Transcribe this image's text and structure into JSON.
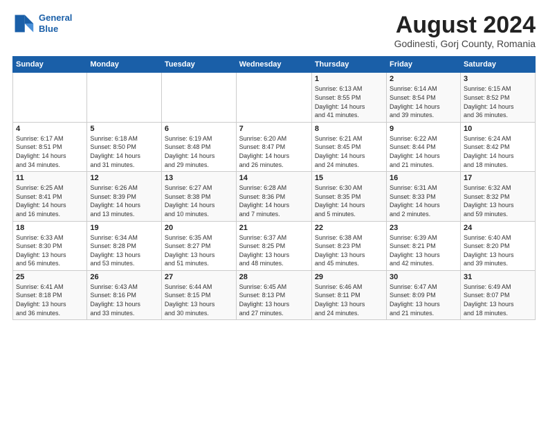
{
  "header": {
    "logo_line1": "General",
    "logo_line2": "Blue",
    "main_title": "August 2024",
    "subtitle": "Godinesti, Gorj County, Romania"
  },
  "calendar": {
    "days_of_week": [
      "Sunday",
      "Monday",
      "Tuesday",
      "Wednesday",
      "Thursday",
      "Friday",
      "Saturday"
    ],
    "weeks": [
      [
        {
          "day": "",
          "info": ""
        },
        {
          "day": "",
          "info": ""
        },
        {
          "day": "",
          "info": ""
        },
        {
          "day": "",
          "info": ""
        },
        {
          "day": "1",
          "info": "Sunrise: 6:13 AM\nSunset: 8:55 PM\nDaylight: 14 hours\nand 41 minutes."
        },
        {
          "day": "2",
          "info": "Sunrise: 6:14 AM\nSunset: 8:54 PM\nDaylight: 14 hours\nand 39 minutes."
        },
        {
          "day": "3",
          "info": "Sunrise: 6:15 AM\nSunset: 8:52 PM\nDaylight: 14 hours\nand 36 minutes."
        }
      ],
      [
        {
          "day": "4",
          "info": "Sunrise: 6:17 AM\nSunset: 8:51 PM\nDaylight: 14 hours\nand 34 minutes."
        },
        {
          "day": "5",
          "info": "Sunrise: 6:18 AM\nSunset: 8:50 PM\nDaylight: 14 hours\nand 31 minutes."
        },
        {
          "day": "6",
          "info": "Sunrise: 6:19 AM\nSunset: 8:48 PM\nDaylight: 14 hours\nand 29 minutes."
        },
        {
          "day": "7",
          "info": "Sunrise: 6:20 AM\nSunset: 8:47 PM\nDaylight: 14 hours\nand 26 minutes."
        },
        {
          "day": "8",
          "info": "Sunrise: 6:21 AM\nSunset: 8:45 PM\nDaylight: 14 hours\nand 24 minutes."
        },
        {
          "day": "9",
          "info": "Sunrise: 6:22 AM\nSunset: 8:44 PM\nDaylight: 14 hours\nand 21 minutes."
        },
        {
          "day": "10",
          "info": "Sunrise: 6:24 AM\nSunset: 8:42 PM\nDaylight: 14 hours\nand 18 minutes."
        }
      ],
      [
        {
          "day": "11",
          "info": "Sunrise: 6:25 AM\nSunset: 8:41 PM\nDaylight: 14 hours\nand 16 minutes."
        },
        {
          "day": "12",
          "info": "Sunrise: 6:26 AM\nSunset: 8:39 PM\nDaylight: 14 hours\nand 13 minutes."
        },
        {
          "day": "13",
          "info": "Sunrise: 6:27 AM\nSunset: 8:38 PM\nDaylight: 14 hours\nand 10 minutes."
        },
        {
          "day": "14",
          "info": "Sunrise: 6:28 AM\nSunset: 8:36 PM\nDaylight: 14 hours\nand 7 minutes."
        },
        {
          "day": "15",
          "info": "Sunrise: 6:30 AM\nSunset: 8:35 PM\nDaylight: 14 hours\nand 5 minutes."
        },
        {
          "day": "16",
          "info": "Sunrise: 6:31 AM\nSunset: 8:33 PM\nDaylight: 14 hours\nand 2 minutes."
        },
        {
          "day": "17",
          "info": "Sunrise: 6:32 AM\nSunset: 8:32 PM\nDaylight: 13 hours\nand 59 minutes."
        }
      ],
      [
        {
          "day": "18",
          "info": "Sunrise: 6:33 AM\nSunset: 8:30 PM\nDaylight: 13 hours\nand 56 minutes."
        },
        {
          "day": "19",
          "info": "Sunrise: 6:34 AM\nSunset: 8:28 PM\nDaylight: 13 hours\nand 53 minutes."
        },
        {
          "day": "20",
          "info": "Sunrise: 6:35 AM\nSunset: 8:27 PM\nDaylight: 13 hours\nand 51 minutes."
        },
        {
          "day": "21",
          "info": "Sunrise: 6:37 AM\nSunset: 8:25 PM\nDaylight: 13 hours\nand 48 minutes."
        },
        {
          "day": "22",
          "info": "Sunrise: 6:38 AM\nSunset: 8:23 PM\nDaylight: 13 hours\nand 45 minutes."
        },
        {
          "day": "23",
          "info": "Sunrise: 6:39 AM\nSunset: 8:21 PM\nDaylight: 13 hours\nand 42 minutes."
        },
        {
          "day": "24",
          "info": "Sunrise: 6:40 AM\nSunset: 8:20 PM\nDaylight: 13 hours\nand 39 minutes."
        }
      ],
      [
        {
          "day": "25",
          "info": "Sunrise: 6:41 AM\nSunset: 8:18 PM\nDaylight: 13 hours\nand 36 minutes."
        },
        {
          "day": "26",
          "info": "Sunrise: 6:43 AM\nSunset: 8:16 PM\nDaylight: 13 hours\nand 33 minutes."
        },
        {
          "day": "27",
          "info": "Sunrise: 6:44 AM\nSunset: 8:15 PM\nDaylight: 13 hours\nand 30 minutes."
        },
        {
          "day": "28",
          "info": "Sunrise: 6:45 AM\nSunset: 8:13 PM\nDaylight: 13 hours\nand 27 minutes."
        },
        {
          "day": "29",
          "info": "Sunrise: 6:46 AM\nSunset: 8:11 PM\nDaylight: 13 hours\nand 24 minutes."
        },
        {
          "day": "30",
          "info": "Sunrise: 6:47 AM\nSunset: 8:09 PM\nDaylight: 13 hours\nand 21 minutes."
        },
        {
          "day": "31",
          "info": "Sunrise: 6:49 AM\nSunset: 8:07 PM\nDaylight: 13 hours\nand 18 minutes."
        }
      ]
    ]
  }
}
